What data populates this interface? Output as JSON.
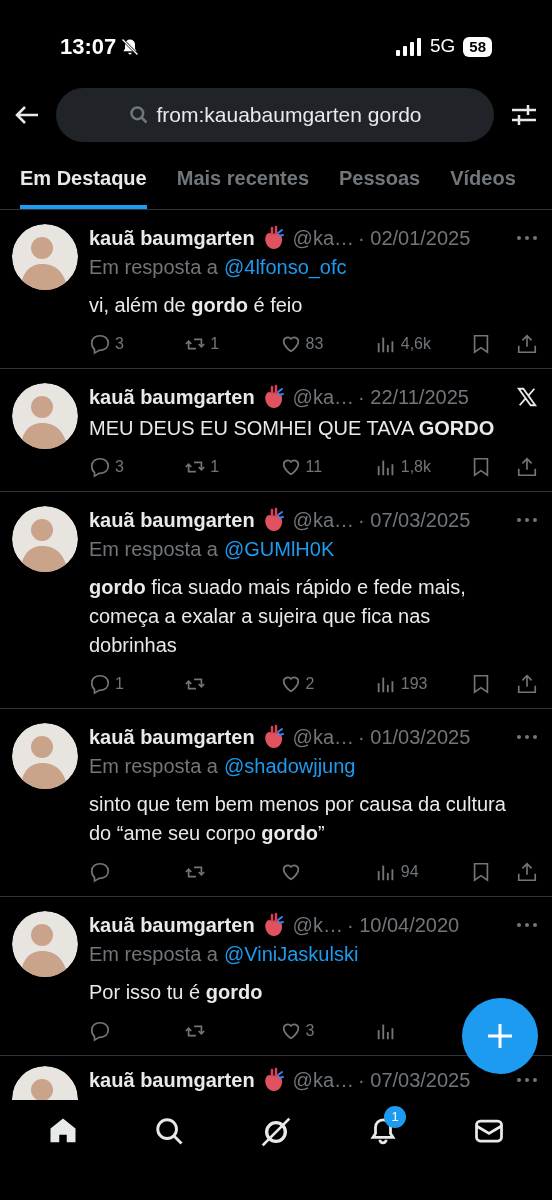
{
  "status_bar": {
    "time": "13:07",
    "network": "5G",
    "battery": "58"
  },
  "search": {
    "value": "from:kauabaumgarten gordo"
  },
  "tabs": [
    {
      "label": "Em Destaque",
      "selected": true
    },
    {
      "label": "Mais recentes",
      "selected": false
    },
    {
      "label": "Pessoas",
      "selected": false
    },
    {
      "label": "Vídeos",
      "selected": false
    }
  ],
  "posts": [
    {
      "kind": "reply",
      "name": "kauã baumgarten",
      "handle": "@ka…",
      "date": "· 02/01/2025",
      "reply_prefix": "Em resposta a",
      "reply_to": "@4lfonso_ofc",
      "text": "vi, além de **gordo** é feio",
      "stats": {
        "replies": "3",
        "reposts": "1",
        "likes": "83",
        "views": "4,6k"
      }
    },
    {
      "kind": "post",
      "name": "kauã baumgarten",
      "handle": "@ka…",
      "date": "· 22/11/2025",
      "text": "MEU DEUS EU SOMHEI QUE TAVA **GORDO**",
      "stats": {
        "replies": "3",
        "reposts": "1",
        "likes": "11",
        "views": "1,8k"
      }
    },
    {
      "kind": "reply",
      "name": "kauã baumgarten",
      "handle": "@ka…",
      "date": "· 07/03/2025",
      "reply_prefix": "Em resposta a",
      "reply_to": "@GUMlH0K",
      "text": "**gordo** fica suado mais rápido e fede mais, começa a exalar a sujeira que fica nas dobrinhas",
      "stats": {
        "replies": "1",
        "likes": "2",
        "views": "193"
      }
    },
    {
      "kind": "reply",
      "name": "kauã baumgarten",
      "handle": "@ka…",
      "date": "· 01/03/2025",
      "reply_prefix": "Em resposta a",
      "reply_to": "@shadowjjung",
      "text": "sinto que tem bem menos por causa da cultura do “ame seu corpo **gordo**”",
      "stats": {
        "views": "94"
      }
    },
    {
      "kind": "reply_covered",
      "name": "kauã baumgarten",
      "handle": "@k…",
      "date": "· 10/04/2020",
      "reply_prefix": "Em resposta a",
      "reply_to": "@ViniJaskulski",
      "text": "Por isso tu é **gordo**",
      "stats": {
        "likes": "3"
      }
    },
    {
      "kind": "partial",
      "name": "kauã baumgarten",
      "handle": "@ka…",
      "date": "· 07/03/2025"
    }
  ],
  "nav": {
    "notifications_badge": "1"
  }
}
